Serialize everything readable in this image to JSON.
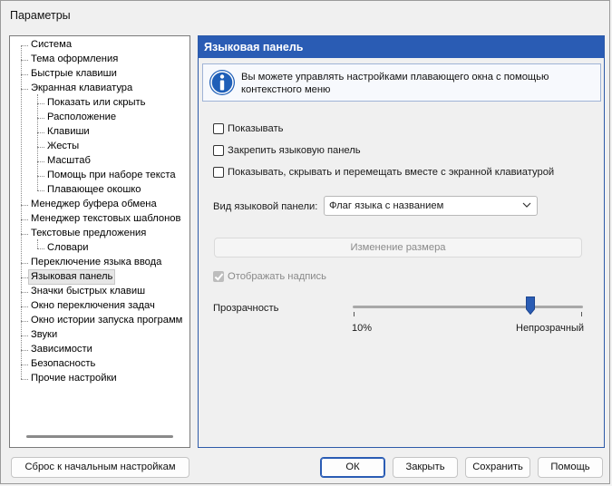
{
  "window": {
    "title": "Параметры"
  },
  "tree": {
    "items": [
      {
        "label": "Система",
        "level": 0
      },
      {
        "label": "Тема оформления",
        "level": 0
      },
      {
        "label": "Быстрые клавиши",
        "level": 0
      },
      {
        "label": "Экранная клавиатура",
        "level": 0
      },
      {
        "label": "Показать или скрыть",
        "level": 1
      },
      {
        "label": "Расположение",
        "level": 1
      },
      {
        "label": "Клавиши",
        "level": 1
      },
      {
        "label": "Жесты",
        "level": 1
      },
      {
        "label": "Масштаб",
        "level": 1
      },
      {
        "label": "Помощь при наборе текста",
        "level": 1
      },
      {
        "label": "Плавающее окошко",
        "level": 1
      },
      {
        "label": "Менеджер буфера обмена",
        "level": 0
      },
      {
        "label": "Менеджер текстовых шаблонов",
        "level": 0
      },
      {
        "label": "Текстовые предложения",
        "level": 0
      },
      {
        "label": "Словари",
        "level": 1
      },
      {
        "label": "Переключение языка ввода",
        "level": 0
      },
      {
        "label": "Языковая панель",
        "level": 0,
        "selected": true
      },
      {
        "label": "Значки быстрых клавиш",
        "level": 0
      },
      {
        "label": "Окно переключения задач",
        "level": 0
      },
      {
        "label": "Окно истории запуска программ",
        "level": 0
      },
      {
        "label": "Звуки",
        "level": 0
      },
      {
        "label": "Зависимости",
        "level": 0
      },
      {
        "label": "Безопасность",
        "level": 0
      },
      {
        "label": "Прочие настройки",
        "level": 0
      }
    ]
  },
  "panel": {
    "header": "Языковая панель",
    "info": "Вы можете управлять настройками плавающего окна с помощью контекстного меню",
    "options": {
      "show": "Показывать",
      "pin": "Закрепить языковую панель",
      "with_keyboard": "Показывать, скрывать и перемещать вместе с экранной клавиатурой"
    },
    "view_label": "Вид языковой панели:",
    "view_value": "Флаг языка с названием",
    "resize_button": "Изменение размера",
    "show_caption": "Отображать надпись",
    "opacity_label": "Прозрачность",
    "opacity_min": "10%",
    "opacity_max": "Непрозрачный",
    "opacity_value": 0.77
  },
  "buttons": {
    "reset": "Сброс к начальным настройкам",
    "ok": "ОК",
    "close": "Закрыть",
    "save": "Сохранить",
    "help": "Помощь"
  },
  "colors": {
    "accent": "#2a5cb4",
    "thumb": "#2a5cb4"
  }
}
